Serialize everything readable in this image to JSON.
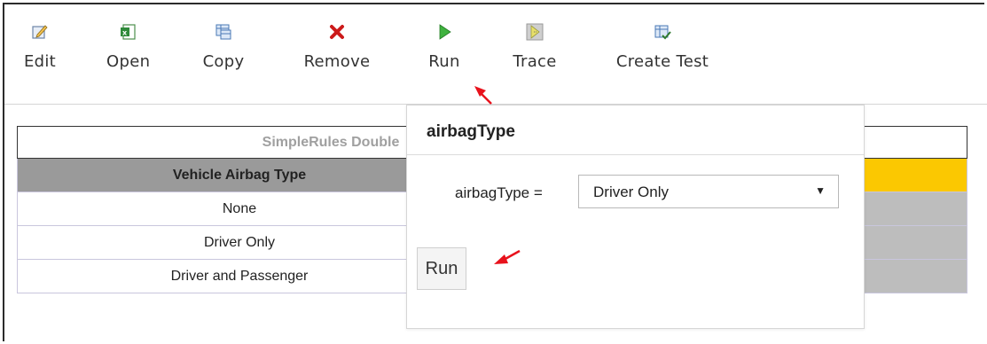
{
  "toolbar": {
    "items": [
      {
        "label": "Edit",
        "icon": "edit-icon"
      },
      {
        "label": "Open",
        "icon": "excel-icon"
      },
      {
        "label": "Copy",
        "icon": "copy-table-icon"
      },
      {
        "label": "Remove",
        "icon": "remove-x-icon"
      },
      {
        "label": "Run",
        "icon": "run-play-icon"
      },
      {
        "label": "Trace",
        "icon": "trace-icon"
      },
      {
        "label": "Create Test",
        "icon": "create-test-icon"
      }
    ]
  },
  "table": {
    "title": "SimpleRules Double",
    "header": "Vehicle Airbag Type",
    "rows": [
      "None",
      "Driver Only",
      "Driver and Passenger"
    ]
  },
  "popup": {
    "title": "airbagType",
    "param_label": "airbagType =",
    "select_value": "Driver Only",
    "run_label": "Run"
  },
  "colors": {
    "header_grey": "#9a9a9a",
    "header_yellow": "#fbc801",
    "cell_grey": "#bdbdbd",
    "arrow_red": "#e8121c",
    "remove_red": "#cc1a1a",
    "run_green": "#3fb23f"
  }
}
